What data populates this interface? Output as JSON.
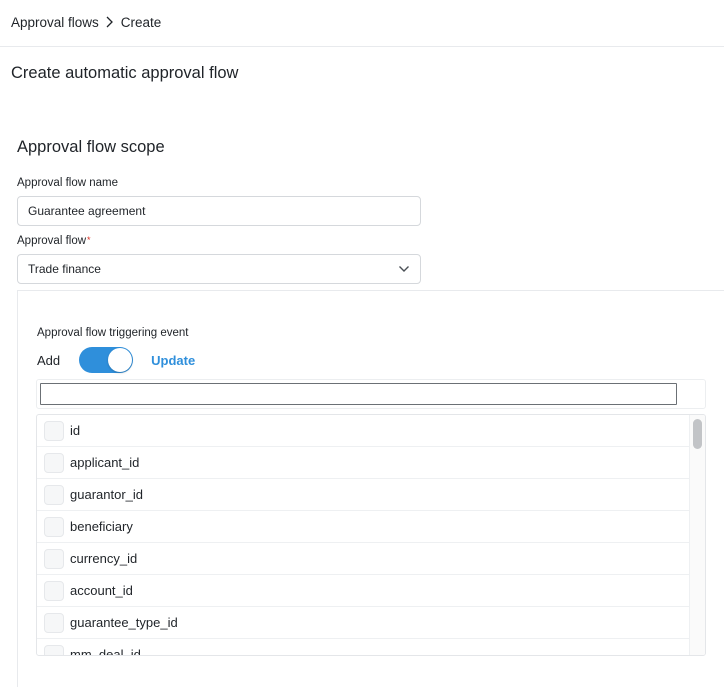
{
  "breadcrumb": {
    "parent": "Approval flows",
    "separator_icon": "chevron-right-icon",
    "current": "Create"
  },
  "page": {
    "title": "Create automatic approval flow"
  },
  "scope": {
    "section_title": "Approval flow scope",
    "name_label": "Approval flow name",
    "name_value": "Guarantee agreement",
    "flow_label": "Approval flow",
    "flow_required_mark": "*",
    "flow_value": "Trade finance",
    "flow_dropdown_icon": "chevron-down-icon"
  },
  "trigger": {
    "label": "Approval flow triggering event",
    "off_label": "Add",
    "on_label": "Update",
    "toggle_state": "on",
    "accent_color": "#2f8fdb",
    "filter_value": "",
    "items": [
      {
        "label": "id",
        "checked": false
      },
      {
        "label": "applicant_id",
        "checked": false
      },
      {
        "label": "guarantor_id",
        "checked": false
      },
      {
        "label": "beneficiary",
        "checked": false
      },
      {
        "label": "currency_id",
        "checked": false
      },
      {
        "label": "account_id",
        "checked": false
      },
      {
        "label": "guarantee_type_id",
        "checked": false
      },
      {
        "label": "mm_deal_id",
        "checked": false
      }
    ]
  }
}
